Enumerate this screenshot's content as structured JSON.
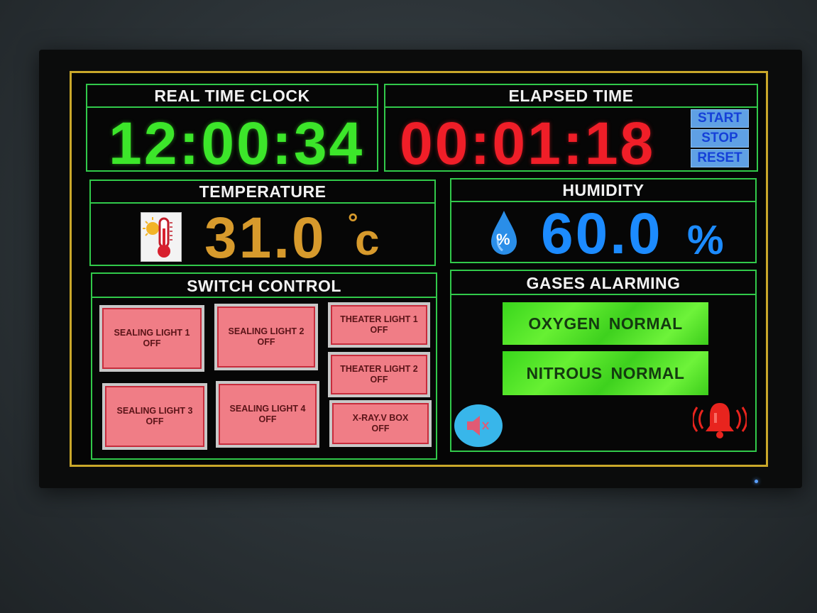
{
  "rtc": {
    "title": "REAL TIME CLOCK",
    "time": "12:00:34"
  },
  "elapsed": {
    "title": "ELAPSED TIME",
    "time": "00:01:18",
    "start_label": "START",
    "stop_label": "STOP",
    "reset_label": "RESET"
  },
  "temperature": {
    "title": "TEMPERATURE",
    "value": "31.0",
    "unit": "c",
    "degree": "°"
  },
  "humidity": {
    "title": "HUMIDITY",
    "value": "60.0",
    "unit": "%",
    "icon_text": "%"
  },
  "switch_control": {
    "title": "SWITCH CONTROL",
    "switches": [
      {
        "name": "SEALING LIGHT 1",
        "state": "OFF"
      },
      {
        "name": "SEALING LIGHT  2",
        "state": "OFF"
      },
      {
        "name": "THEATER LIGHT 1",
        "state": "OFF"
      },
      {
        "name": "THEATER LIGHT 2",
        "state": "OFF"
      },
      {
        "name": "SEALING LIGHT  3",
        "state": "OFF"
      },
      {
        "name": "SEALING LIGHT  4",
        "state": "OFF"
      },
      {
        "name": "X-RAY.V BOX",
        "state": "OFF"
      }
    ]
  },
  "gases": {
    "title": "GASES ALARMING",
    "items": [
      {
        "gas": "OXYGEN",
        "status": "NORMAL"
      },
      {
        "gas": "NITROUS",
        "status": "NORMAL"
      }
    ]
  },
  "colors": {
    "clock_green": "#3ce62a",
    "elapsed_red": "#f01e28",
    "temp_orange": "#d79a2c",
    "humidity_blue": "#1c8bff",
    "frame_gold": "#c9a72a",
    "panel_green": "#31c94a"
  },
  "icons": {
    "thermometer": "thermometer-sun-icon",
    "drop": "humidity-drop-icon",
    "mute": "mute-speaker-icon",
    "bell": "alarm-bell-icon"
  }
}
